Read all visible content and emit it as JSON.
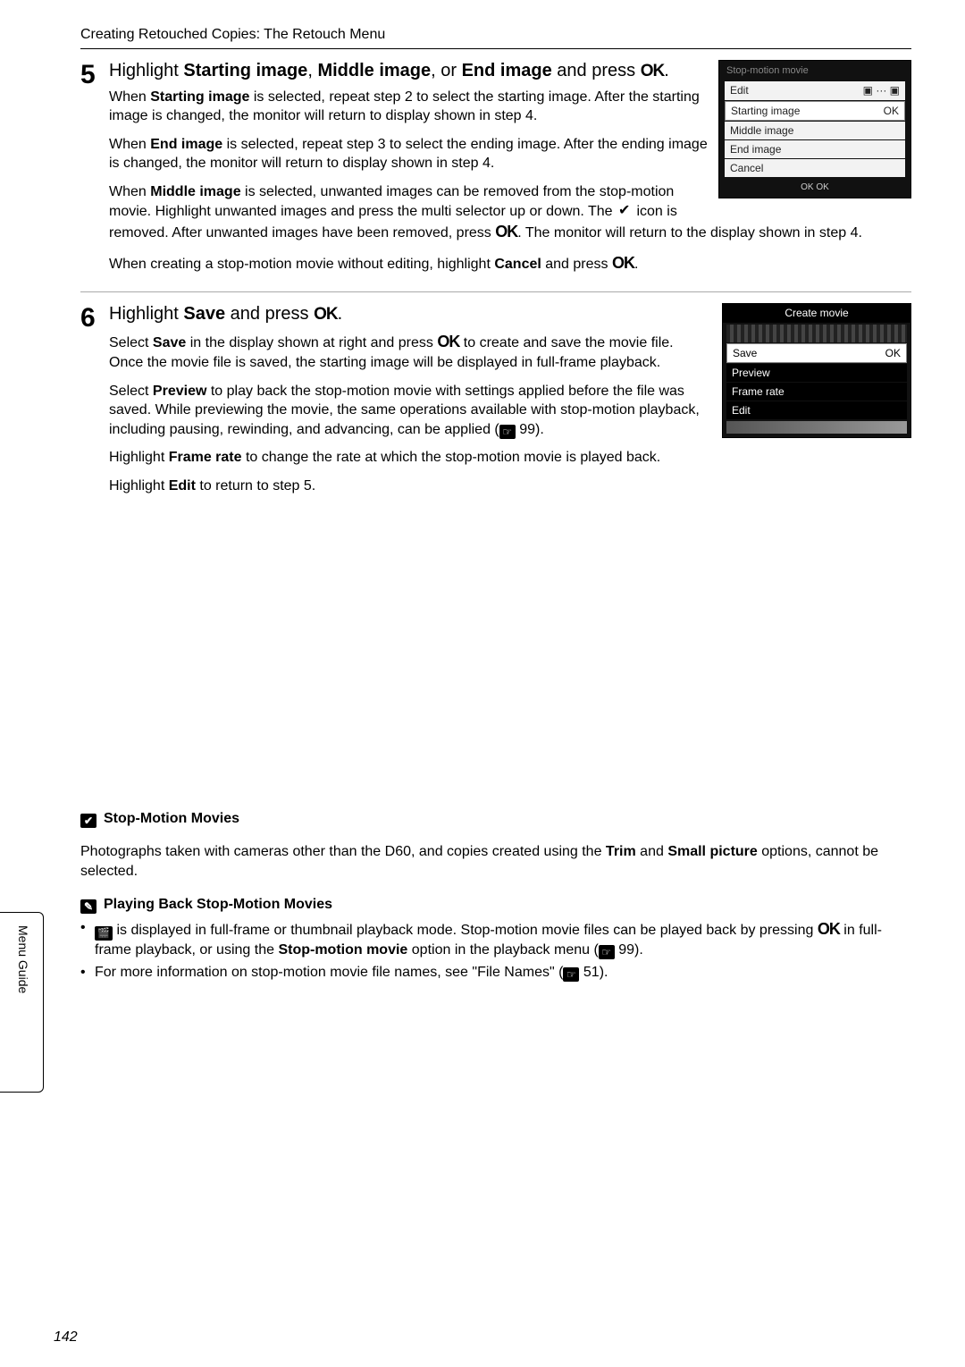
{
  "header": {
    "running_head": "Creating Retouched Copies: The Retouch Menu"
  },
  "step5": {
    "num": "5",
    "title_pre": "Highlight ",
    "title_boldA": "Starting image",
    "title_mid1": ", ",
    "title_boldB": "Middle image",
    "title_mid2": ", or ",
    "title_boldC": "End image",
    "title_post": " and press ",
    "title_ok": "OK",
    "title_end": ".",
    "p1_a": "When ",
    "p1_b": "Starting image",
    "p1_c": " is selected, repeat step 2 to select the starting image. After the starting image is changed, the monitor will return to display shown in step 4.",
    "p2_a": "When ",
    "p2_b": "End image",
    "p2_c": " is selected, repeat step 3 to select the ending image. After the ending image is changed, the monitor will return to display shown in step 4.",
    "p3_a": "When ",
    "p3_b": "Middle image",
    "p3_c": " is selected, unwanted images can be removed from the stop-motion movie. Highlight unwanted images and press the multi selector up or down. The ",
    "p3_d": " icon is removed. After unwanted images have been removed, press ",
    "p3_ok": "OK",
    "p3_e": ". The monitor will return to the display shown in step 4.",
    "p4_a": "When creating a stop-motion movie without editing, highlight ",
    "p4_b": "Cancel",
    "p4_c": " and press ",
    "p4_ok": "OK",
    "p4_d": "."
  },
  "lcd1": {
    "title": "Stop-motion movie",
    "edit": "Edit",
    "r1": "Starting image",
    "r1_ok": "OK",
    "r2": "Middle image",
    "r3": "End image",
    "r4": "Cancel",
    "foot": "OK OK"
  },
  "step6": {
    "num": "6",
    "title_pre": "Highlight ",
    "title_bold": "Save",
    "title_mid": " and press ",
    "title_ok": "OK",
    "title_end": ".",
    "p1_a": "Select ",
    "p1_b": "Save",
    "p1_c": " in the display shown at right and press ",
    "p1_ok": "OK",
    "p1_d": " to create and save the movie file. Once the movie file is saved, the starting image will be displayed in full-frame playback.",
    "p2_a": "Select ",
    "p2_b": "Preview",
    "p2_c": " to play back the stop-motion movie with settings applied before the file was saved. While previewing the movie, the same operations available with stop-motion playback, including pausing, rewinding, and advancing, can be applied (",
    "p2_ref": "99",
    "p2_d": ").",
    "p3_a": "Highlight ",
    "p3_b": "Frame rate",
    "p3_c": " to change the rate at which the stop-motion movie is played back.",
    "p4_a": "Highlight ",
    "p4_b": "Edit",
    "p4_c": " to return to step 5."
  },
  "lcd2": {
    "title": "Create movie",
    "r1": "Save",
    "r1_ok": "OK",
    "r2": "Preview",
    "r3": "Frame rate",
    "r4": "Edit"
  },
  "side_tab": "Menu Guide",
  "noteA": {
    "head": "Stop-Motion Movies",
    "body_a": "Photographs taken with cameras other than the D60, and copies created using the ",
    "body_b": "Trim",
    "body_c": " and ",
    "body_d": "Small picture",
    "body_e": " options, cannot be selected."
  },
  "noteB": {
    "head": "Playing Back Stop-Motion Movies",
    "li1_a": " is displayed in full-frame or thumbnail playback mode. Stop-motion movie files can be played back by pressing ",
    "li1_ok": "OK",
    "li1_b": " in full-frame playback, or using the ",
    "li1_c": "Stop-motion movie",
    "li1_d": " option in the playback menu (",
    "li1_ref": "99",
    "li1_e": ").",
    "li2_a": "For more information on stop-motion movie file names, see \"File Names\" (",
    "li2_ref": "51",
    "li2_b": ")."
  },
  "page_number": "142"
}
